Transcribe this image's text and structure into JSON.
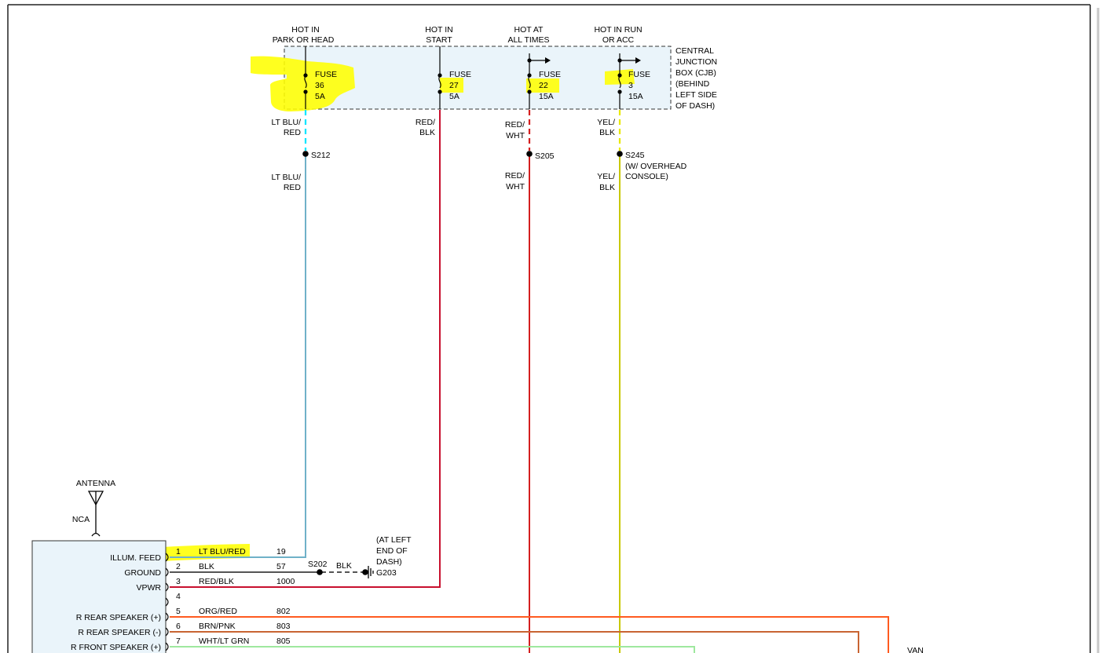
{
  "colors": {
    "lt_blu_red": "#6fb1c8",
    "lt_blu_red_cjb": "#00e5ff",
    "red_blk": "#c8102e",
    "red_wht": "#d41f1f",
    "yel_blk": "#e8e800",
    "blk": "#000000",
    "org_red": "#ff5a1f",
    "brn_pnk": "#c86432",
    "wht_lt_grn": "#9ee89e",
    "highlight": "#ffff00",
    "cjb_fill": "#eaf4fa",
    "radio_fill": "#eaf4fa"
  },
  "cjb": {
    "label_lines": [
      "CENTRAL",
      "JUNCTION",
      "BOX (CJB)",
      "(BEHIND",
      "LEFT SIDE",
      "OF DASH)"
    ]
  },
  "fuses": [
    {
      "header": [
        "HOT IN",
        "PARK OR HEAD"
      ],
      "lines": [
        "FUSE",
        "36",
        "5A"
      ]
    },
    {
      "header": [
        "HOT IN",
        "START"
      ],
      "lines": [
        "FUSE",
        "27",
        "5A"
      ]
    },
    {
      "header": [
        "HOT AT",
        "ALL TIMES"
      ],
      "lines": [
        "FUSE",
        "22",
        "15A"
      ]
    },
    {
      "header": [
        "HOT IN RUN",
        "OR ACC"
      ],
      "lines": [
        "FUSE",
        "3",
        "15A"
      ]
    }
  ],
  "wire_labels": {
    "f36_top": [
      "LT BLU/",
      "RED"
    ],
    "f36_bottom": [
      "LT BLU/",
      "RED"
    ],
    "f27": [
      "RED/",
      "BLK"
    ],
    "f22_top": [
      "RED/",
      "WHT"
    ],
    "f22_bottom": [
      "RED/",
      "WHT"
    ],
    "f3_top": [
      "YEL/",
      "BLK"
    ],
    "f3_bottom": [
      "YEL/",
      "BLK"
    ]
  },
  "splices": {
    "s212": "S212",
    "s205": "S205",
    "s245": "S245",
    "s245_note": [
      "(W/ OVERHEAD",
      "CONSOLE)"
    ],
    "s202": "S202"
  },
  "ground": {
    "wire": "BLK",
    "id": "G203",
    "note": [
      "(AT LEFT",
      "END OF",
      "DASH)"
    ]
  },
  "antenna": {
    "label": "ANTENNA",
    "nca": "NCA"
  },
  "pins": [
    {
      "name": "ILLUM. FEED",
      "pin": "1",
      "wire": "LT BLU/RED",
      "circuit": "19"
    },
    {
      "name": "GROUND",
      "pin": "2",
      "wire": "BLK",
      "circuit": "57"
    },
    {
      "name": "VPWR",
      "pin": "3",
      "wire": "RED/BLK",
      "circuit": "1000"
    },
    {
      "name": "",
      "pin": "4",
      "wire": "",
      "circuit": ""
    },
    {
      "name": "R REAR SPEAKER (+)",
      "pin": "5",
      "wire": "ORG/RED",
      "circuit": "802"
    },
    {
      "name": "R REAR SPEAKER (-)",
      "pin": "6",
      "wire": "BRN/PNK",
      "circuit": "803"
    },
    {
      "name": "R FRONT SPEAKER (+)",
      "pin": "7",
      "wire": "WHT/LT GRN",
      "circuit": "805"
    }
  ],
  "van_label": "VAN"
}
